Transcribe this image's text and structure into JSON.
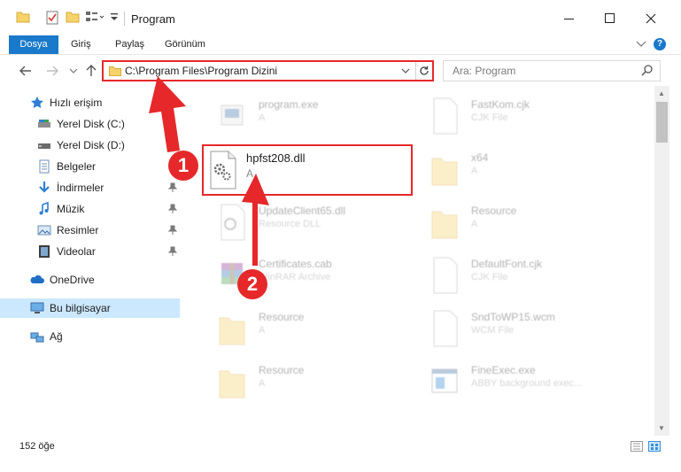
{
  "window": {
    "title": "Program",
    "minimize": "—",
    "maximize": "☐",
    "close": "✕"
  },
  "ribbon": {
    "tabs": [
      {
        "label": "Dosya",
        "active": true
      },
      {
        "label": "Giriş"
      },
      {
        "label": "Paylaş"
      },
      {
        "label": "Görünüm"
      }
    ],
    "help": "?"
  },
  "address": {
    "path": "C:\\Program Files\\Program Dizini",
    "search_placeholder": "Ara: Program"
  },
  "nav": {
    "items": [
      {
        "label": "Hızlı erişim",
        "icon": "star-icon",
        "pinned": false
      },
      {
        "label": "Yerel Disk (C:)",
        "icon": "drive-c-icon",
        "pinned": false
      },
      {
        "label": "Yerel Disk (D:)",
        "icon": "drive-d-icon",
        "pinned": false
      },
      {
        "label": "Belgeler",
        "icon": "documents-icon",
        "pinned": true
      },
      {
        "label": "İndirmeler",
        "icon": "downloads-icon",
        "pinned": true
      },
      {
        "label": "Müzik",
        "icon": "music-icon",
        "pinned": true
      },
      {
        "label": "Resimler",
        "icon": "pictures-icon",
        "pinned": true
      },
      {
        "label": "Videolar",
        "icon": "videos-icon",
        "pinned": true
      },
      {
        "label": "OneDrive",
        "icon": "onedrive-icon",
        "pinned": false
      },
      {
        "label": "Bu bilgisayar",
        "icon": "this-pc-icon",
        "pinned": false,
        "selected": true
      },
      {
        "label": "Ağ",
        "icon": "network-icon",
        "pinned": false
      }
    ]
  },
  "files": [
    {
      "name": "program.exe",
      "sub": "A",
      "icon": "exe-icon"
    },
    {
      "name": "FastKom.cjk",
      "sub": "CJK File",
      "icon": "file-icon"
    },
    {
      "name": "hpfst208.dll",
      "sub": "A",
      "icon": "dll-gear-icon",
      "highlighted": true
    },
    {
      "name": "x64",
      "sub": "A",
      "icon": "folder-icon"
    },
    {
      "name": "UpdateClient65.dll",
      "sub": "Resource DLL",
      "icon": "dll-gear-icon"
    },
    {
      "name": "Resource",
      "sub": "A",
      "icon": "folder-icon"
    },
    {
      "name": "Certificates.cab",
      "sub": "WinRAR Archive",
      "icon": "winrar-icon"
    },
    {
      "name": "DefaultFont.cjk",
      "sub": "CJK File",
      "icon": "file-icon"
    },
    {
      "name": "Resource",
      "sub": "A",
      "icon": "folder-icon"
    },
    {
      "name": "SndToWP15.wcm",
      "sub": "WCM File",
      "icon": "file-icon"
    },
    {
      "name": "Resource",
      "sub": "A",
      "icon": "folder-icon"
    },
    {
      "name": "FineExec.exe",
      "sub": "ABBY background exec...",
      "icon": "app-window-icon"
    }
  ],
  "status": {
    "count": "152 öğe"
  },
  "annotations": {
    "step1": "1",
    "step2": "2",
    "color": "#e6282a"
  }
}
